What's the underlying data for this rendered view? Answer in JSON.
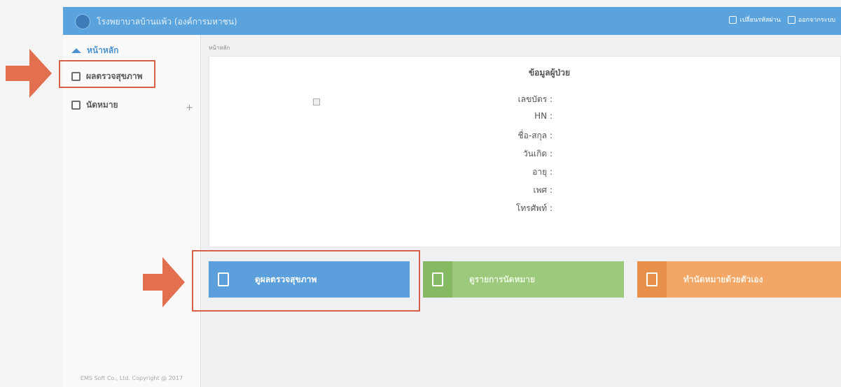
{
  "header": {
    "title": "โรงพยาบาลบ้านแพ้ว (องค์การมหาชน)",
    "actions": [
      {
        "label": "เปลี่ยนรหัสผ่าน",
        "icon": "lock-icon"
      },
      {
        "label": "ออกจากระบบ",
        "icon": "logout-icon"
      }
    ]
  },
  "sidebar": {
    "items": [
      {
        "label": "หน้าหลัก",
        "icon": "home-icon"
      },
      {
        "label": "ผลตรวจสุขภาพ",
        "icon": "document-icon"
      },
      {
        "label": "นัดหมาย",
        "icon": "calendar-icon",
        "expand": "+"
      }
    ],
    "copyright": "EMS Soft Co., Ltd. Copyright @ 2017"
  },
  "breadcrumb": "หน้าหลัก",
  "patient": {
    "title": "ข้อมูลผู้ป่วย",
    "fields": [
      "เลขบัตร :",
      "HN :",
      "ชื่อ-สกุล :",
      "วันเกิด :",
      "อายุ :",
      "เพศ :",
      "โทรศัพท์ :"
    ]
  },
  "tiles": [
    {
      "label": "ดูผลตรวจสุขภาพ",
      "icon": "clipboard-icon",
      "color": "#5b9fdc"
    },
    {
      "label": "ดูรายการนัดหมาย",
      "icon": "calendar-icon",
      "color": "#9cc97c"
    },
    {
      "label": "ทำนัดหมายด้วยตัวเอง",
      "icon": "note-icon",
      "color": "#f2a766"
    }
  ],
  "colors": {
    "header": "#5aa3dc",
    "highlight": "#d9614a",
    "arrow": "#e26f4f"
  }
}
